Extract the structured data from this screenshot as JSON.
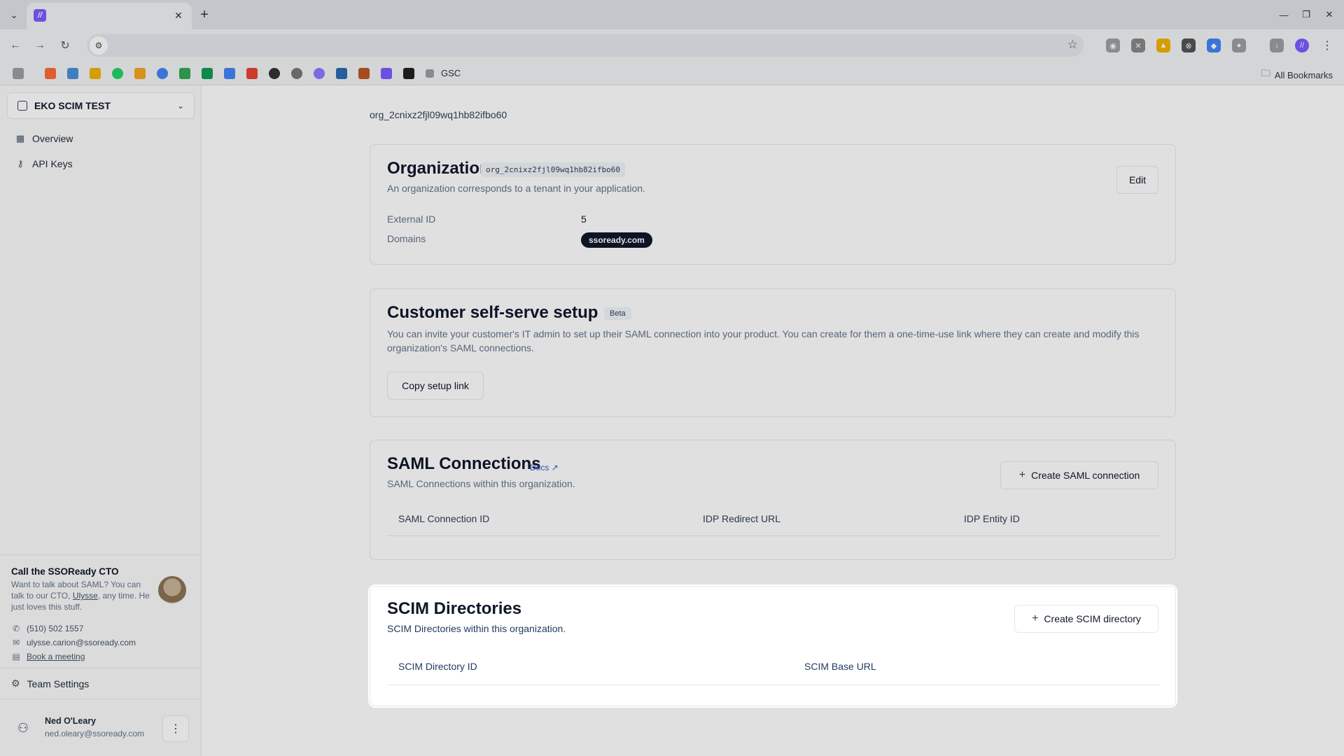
{
  "browser": {
    "new_tab_symbol": "+",
    "bookmarks": {
      "gsc_label": "GSC",
      "all_bookmarks_label": "All Bookmarks"
    }
  },
  "sidebar": {
    "org_switcher": "EKO SCIM TEST",
    "nav": [
      {
        "label": "Overview",
        "icon": "grid-icon"
      },
      {
        "label": "API Keys",
        "icon": "key-icon"
      }
    ],
    "cto": {
      "title": "Call the SSOReady CTO",
      "desc_prefix": "Want to talk about SAML? You can talk to our CTO, ",
      "desc_link": "Ulysse",
      "desc_suffix": ", any time. He just loves this stuff.",
      "phone": "(510) 502 1557",
      "email": "ulysse.carion@ssoready.com",
      "meeting": "Book a meeting"
    },
    "team_settings": "Team Settings",
    "user": {
      "name": "Ned O'Leary",
      "email": "ned.oleary@ssoready.com"
    }
  },
  "main": {
    "breadcrumb": "org_2cnixz2fjl09wq1hb82ifbo60",
    "organization": {
      "title": "Organization",
      "id_tag": "org_2cnixz2fjl09wq1hb82ifbo60",
      "subtitle": "An organization corresponds to a tenant in your application.",
      "edit_label": "Edit",
      "external_id_label": "External ID",
      "external_id_value": "5",
      "domains_label": "Domains",
      "domains": [
        "ssoready.com"
      ]
    },
    "self_serve": {
      "title": "Customer self-serve setup",
      "badge": "Beta",
      "desc": "You can invite your customer's IT admin to set up their SAML connection into your product. You can create for them a one-time-use link where they can create and modify this organization's SAML connections.",
      "button": "Copy setup link"
    },
    "saml": {
      "title": "SAML Connections",
      "docs_label": "Docs ↗",
      "subtitle": "SAML Connections within this organization.",
      "button": "Create SAML connection",
      "columns": [
        "SAML Connection ID",
        "IDP Redirect URL",
        "IDP Entity ID"
      ]
    },
    "scim": {
      "title": "SCIM Directories",
      "subtitle": "SCIM Directories within this organization.",
      "button": "Create SCIM directory",
      "columns": [
        "SCIM Directory ID",
        "SCIM Base URL"
      ]
    }
  },
  "colors": {
    "accent": "#7c5cff",
    "pill_bg": "#0f172a",
    "overlay": "rgba(0,0,0,0.12)"
  }
}
